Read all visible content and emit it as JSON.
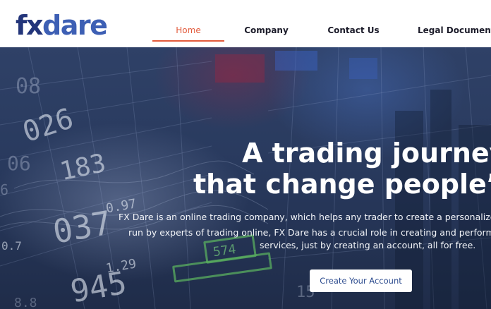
{
  "brand": {
    "logo_fx": "fx",
    "logo_dare": "dare"
  },
  "nav": {
    "items": [
      {
        "label": "Home",
        "active": true
      },
      {
        "label": "Company",
        "active": false
      },
      {
        "label": "Contact Us",
        "active": false
      },
      {
        "label": "Legal Documents",
        "active": false
      }
    ]
  },
  "hero": {
    "title_line1": "A trading journey",
    "title_line2": "that change people’s li",
    "text_line1": "FX Dare is an online trading company, which helps any trader to create a personalized trad",
    "text_line2": "run by experts of trading online, FX Dare has a crucial role in creating and performing th",
    "text_line3": "services, just by creating an account, all for free.",
    "cta_label": "Create Your Account"
  },
  "background_numbers": {
    "n1": "026",
    "n2": "183",
    "n3": "037",
    "n4": "945",
    "n5": "0.97",
    "n6": "1.29",
    "n7": "0.7",
    "n8": "574",
    "n9": "06",
    "n10": "15",
    "n11": "08",
    "n12": "8.8",
    "n13": "6"
  },
  "colors": {
    "accent": "#e25a3b",
    "brand_dark": "#23357a",
    "brand_light": "#3d5fb4",
    "cta_text": "#2d4c8f"
  }
}
